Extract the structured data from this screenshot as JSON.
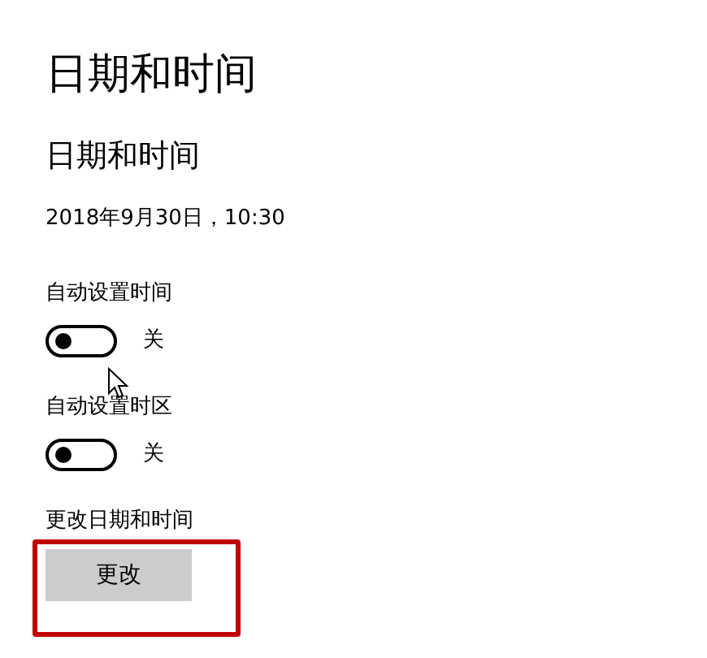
{
  "page_title": "日期和时间",
  "section_title": "日期和时间",
  "current_datetime": "2018年9月30日，10:30",
  "toggles": [
    {
      "label": "自动设置时间",
      "on": false,
      "state_text": "关"
    },
    {
      "label": "自动设置时区",
      "on": false,
      "state_text": "关"
    }
  ],
  "change": {
    "label": "更改日期和时间",
    "button": "更改",
    "highlighted": true
  }
}
